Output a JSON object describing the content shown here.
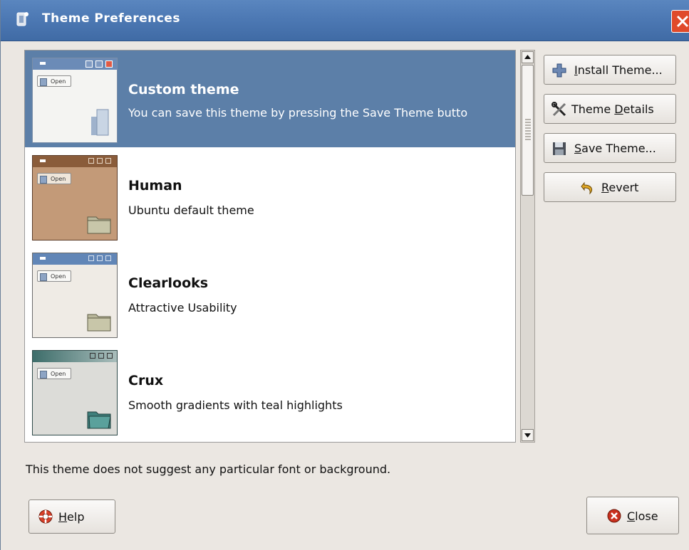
{
  "window": {
    "title": "Theme Preferences"
  },
  "themes": [
    {
      "name": "Custom theme",
      "description": "You can save this theme by pressing the Save Theme butto",
      "selected": true
    },
    {
      "name": "Human",
      "description": "Ubuntu default theme",
      "selected": false
    },
    {
      "name": "Clearlooks",
      "description": "Attractive Usability",
      "selected": false
    },
    {
      "name": "Crux",
      "description": "Smooth gradients with teal highlights",
      "selected": false
    }
  ],
  "thumb_open_label": "Open",
  "buttons": {
    "install": {
      "pre": "",
      "mn": "I",
      "post": "nstall Theme..."
    },
    "details": {
      "pre": "Theme ",
      "mn": "D",
      "post": "etails"
    },
    "save": {
      "pre": "",
      "mn": "S",
      "post": "ave Theme..."
    },
    "revert": {
      "pre": "",
      "mn": "R",
      "post": "evert"
    },
    "help": {
      "pre": "",
      "mn": "H",
      "post": "elp"
    },
    "close": {
      "pre": "",
      "mn": "C",
      "post": "lose"
    }
  },
  "status": "This theme does not suggest any particular font or background.",
  "colors": {
    "titlebar": "#4d79b4",
    "selection": "#5c7fa8",
    "close": "#e04a2a"
  },
  "icons": {
    "title": "theme-icon",
    "install": "plus-icon",
    "details": "tools-icon",
    "save": "floppy-icon",
    "revert": "revert-arrow-icon",
    "help": "lifebuoy-icon",
    "close": "close-circle-icon"
  }
}
